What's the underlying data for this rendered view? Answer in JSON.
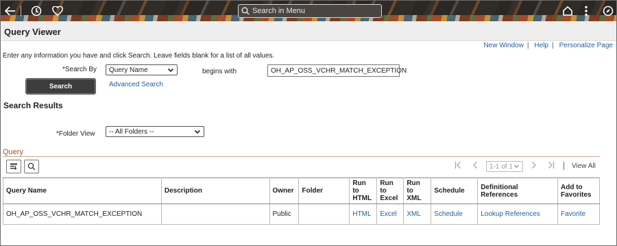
{
  "banner": {
    "search_placeholder": "Search in Menu"
  },
  "page": {
    "title": "Query Viewer"
  },
  "top_links": [
    "New Window",
    "Help",
    "Personalize Page"
  ],
  "instructions": "Enter any information you have and click Search. Leave fields blank for a list of all values.",
  "search_form": {
    "search_by_label": "*Search By",
    "search_by_value": "Query Name",
    "operator_label": "begins with",
    "query_value": "OH_AP_OSS_VCHR_MATCH_EXCEPTION",
    "search_button": "Search",
    "advanced_link": "Advanced Search"
  },
  "results": {
    "title": "Search Results",
    "folder_view_label": "*Folder View",
    "folder_view_value": "-- All Folders --",
    "grid_title": "Query",
    "pager_text": "1-1 of 1",
    "view_all": "View All",
    "columns": [
      "Query Name",
      "Description",
      "Owner",
      "Folder",
      "Run to HTML",
      "Run to Excel",
      "Run to XML",
      "Schedule",
      "Definitional References",
      "Add to Favorites"
    ],
    "rows": [
      {
        "query_name": "OH_AP_OSS_VCHR_MATCH_EXCEPTION",
        "description": "",
        "owner": "Public",
        "folder": "",
        "html": "HTML",
        "excel": "Excel",
        "xml": "XML",
        "schedule": "Schedule",
        "references": "Lookup References",
        "favorite": "Favorite"
      }
    ]
  }
}
